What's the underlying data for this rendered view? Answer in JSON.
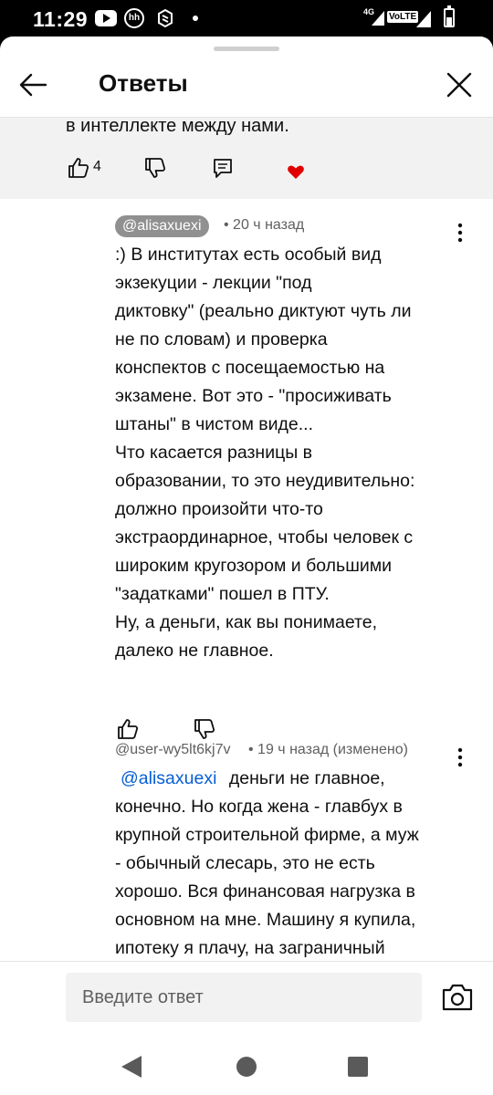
{
  "status_bar": {
    "time": "11:29",
    "icons": [
      "youtube-icon",
      "hh-icon",
      "box-icon",
      "notification-dot-icon",
      "signal-4g-icon",
      "volte-icon",
      "signal-icon",
      "battery-icon"
    ],
    "network": "4G",
    "volte": "VoLTE",
    "hh": "hh"
  },
  "header": {
    "title": "Ответы",
    "back_icon": "arrow-left-icon",
    "close_icon": "close-icon"
  },
  "parent_comment": {
    "text_tail": "в интеллекте между нами.",
    "like_count": "4",
    "creator_heart": true,
    "colors": {
      "heart": "#e00000",
      "background": "#f2f2f2"
    }
  },
  "replies": [
    {
      "author": "@alisaxuexi",
      "meta": "• 20 ч назад",
      "is_highlighted_author": true,
      "lines": [
        ":) В институтах есть особый вид",
        "экзекуции - лекции \"под",
        "диктовку\" (реально диктуют чуть ли",
        "не по словам) и проверка",
        "конспектов с посещаемостью на",
        "экзамене. Вот это - \"просиживать",
        "штаны\" в чистом виде...",
        "Что касается разницы в",
        "образовании, то это неудивительно:",
        "должно произойти что-то",
        "экстраординарное, чтобы человек с",
        "широким кругозором и большими",
        "\"задатками\" пошел в ПТУ.",
        "Ну, а деньги, как вы понимаете,",
        "далеко не главное."
      ]
    },
    {
      "author": "@user-wy5lt6kj7v",
      "meta": "• 19 ч назад (изменено)",
      "mention": "@alisaxuexi",
      "first_line_rest": "деньги не главное,",
      "lines": [
        "конечно. Но когда жена - главбух в",
        "крупной строительной фирме, а муж",
        "- обычный слесарь, это не есть",
        "хорошо. Вся финансовая нагрузка в",
        "основном на мне. Машину я купила,",
        "ипотеку я плачу, на заграничный"
      ]
    }
  ],
  "input": {
    "placeholder": "Введите ответ",
    "camera_icon": "camera-icon"
  },
  "nav": {
    "back_icon": "nav-back-icon",
    "home_icon": "nav-home-icon",
    "recents_icon": "nav-recents-icon"
  },
  "colors": {
    "mention": "#065fd4",
    "author_chip": "#909090",
    "meta": "#606060"
  }
}
